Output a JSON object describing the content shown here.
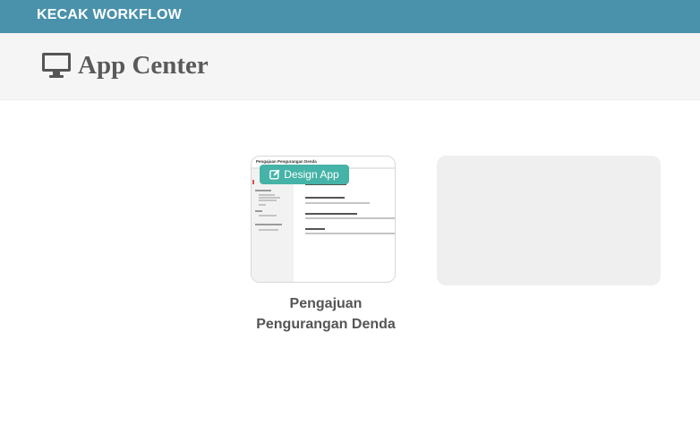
{
  "topbar": {
    "brand": "KECAK WORKFLOW"
  },
  "header": {
    "title": "App Center",
    "icon": "monitor-icon"
  },
  "apps": [
    {
      "name": "Pengajuan Pengurangan Denda",
      "design_button_label": "Design App",
      "design_icon": "edit-icon",
      "thumbnail_title": "Pengajuan Pengurangan Denda"
    }
  ],
  "colors": {
    "topbar": "#4a92ab",
    "header_bg": "#f5f5f5",
    "design_button": "#45b3a7",
    "placeholder": "#efefef"
  }
}
